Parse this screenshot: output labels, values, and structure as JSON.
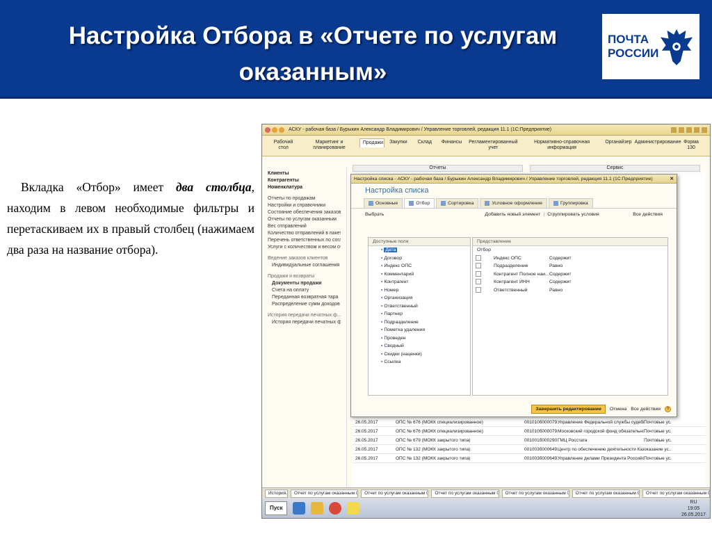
{
  "slide": {
    "title": "Настройка Отбора в «Отчете по услугам оказанным»",
    "logo_line1": "ПОЧТА",
    "logo_line2": "РОССИИ",
    "desc_before": "Вкладка «Отбор» имеет ",
    "desc_emph": "два столбца",
    "desc_after": ", находим в левом необходимые фильтры и перетаскиваем их в правый столбец (нажимаем два раза на название отбора)."
  },
  "app": {
    "title": "АСКУ - рабочая база / Бурыкин Александр Владимирович / Управление торговлей, редакция 11.1 (1С:Предприятие)",
    "sections": [
      "Рабочий стол",
      "Маркетинг и планирование",
      "Продажи",
      "Закупки",
      "Склад",
      "Финансы",
      "Регламентированный учет",
      "Нормативно-справочная информация",
      "Органайзер",
      "Администрирование",
      "Форма 130"
    ],
    "active_section": "Продажи",
    "subtabs": [
      "Отчеты",
      "Сервис"
    ],
    "sidebar": {
      "main": [
        "Клиенты",
        "Контрагенты",
        "Номенклатура"
      ],
      "reports": [
        "Отчеты по продажам",
        "Настройки и справочники",
        "Состояние обеспечения заказов",
        "Отчеты по услугам оказанным",
        "Вес отправлений",
        "Количество отправлений в пакете",
        "Перечень ответственных по соглашениям",
        "Услуги с количеством и весом отправле..."
      ],
      "group1": "Ведение заказов клиентов",
      "g1items": [
        "Индивидуальные соглашения с клиент..."
      ],
      "group2": "Продажи и возвраты",
      "g2items": [
        "Документы продажи",
        "Счета на оплату",
        "Переданная возвратная тара",
        "Распределение сумм доходов на период"
      ],
      "group3": "История передачи печатных ф...",
      "g3items": [
        "История передачи печатных форм"
      ]
    },
    "rows": [
      {
        "date": "26.05.2017",
        "ops": "ОПС № 676 (МОКК специализированное)",
        "code": "001010б000079...",
        "org": "Управление Федеральной службы судебных при...",
        "type": "Почтовые ус..."
      },
      {
        "date": "26.05.2017",
        "ops": "ОПС № 676 (МОКК специализированное)",
        "code": "001010б000079...",
        "org": "Московский городской фонд обязательного мед...",
        "type": "Почтовые ус..."
      },
      {
        "date": "26.05.2017",
        "ops": "ОПС № 679 (МОКК закрытого типа)",
        "code": "001001б000290...",
        "org": "ГМЦ Росстата",
        "type": "Почтовые ус..."
      },
      {
        "date": "26.05.2017",
        "ops": "ОПС № 132 (МОКК закрытого типа)",
        "code": "001003б000649...",
        "org": "Центр по обеспечению деятельности Казначейст...",
        "type": "оказание ус..."
      },
      {
        "date": "26.05.2017",
        "ops": "ОПС № 132 (МОКК закрытого типа)",
        "code": "001003б000649...",
        "org": "Управление делами Президента Российской Фе...",
        "type": "Почтовые ус..."
      }
    ],
    "taskbar_items": [
      "История...",
      "Отчет по услугам оказанным 001000...",
      "Отчет по услугам оказанным 001000...",
      "Отчет по услугам оказанным 001000...",
      "Отчет по услугам оказанным 001000...",
      "Отчет по услугам оказанным 001000...",
      "Отчет по услугам оказанным 001003..."
    ],
    "start": "Пуск",
    "lang": "RU",
    "time": "19:05",
    "date": "26.05.2017"
  },
  "dialog": {
    "title": "Настройка списка - АСКУ - рабочая база / Бурыкин Александр Владимирович / Управление торговлей, редакция 11.1 (1С:Предприятие)",
    "heading": "Настройка списка",
    "tabs": [
      "Основные",
      "Отбор",
      "Сортировка",
      "Условное оформление",
      "Группировка"
    ],
    "active_tab": "Отбор",
    "choose_label": "Выбрать",
    "add_element": "Добавить новый элемент",
    "group_conditions": "Сгруппировать условия",
    "all_actions": "Все действия",
    "left_header": "Доступные поля",
    "left_items": [
      "Дата",
      "Договор",
      "Индекс ОПС",
      "Комментарий",
      "Контрагент",
      "Номер",
      "Организация",
      "Ответственный",
      "Партнер",
      "Подразделение",
      "Пометка удаления",
      "Проведен",
      "Сводный",
      "Скидки (наценки)",
      "Ссылка"
    ],
    "right_header": "Представление",
    "right_root": "Отбор",
    "right_items": [
      {
        "field": "Индекс ОПС",
        "cond": "Содержит"
      },
      {
        "field": "Подразделение",
        "cond": "Равно"
      },
      {
        "field": "Контрагент Полное наи...",
        "cond": "Содержит"
      },
      {
        "field": "Контрагент ИНН",
        "cond": "Содержит"
      },
      {
        "field": "Ответственный",
        "cond": "Равно"
      }
    ],
    "finish_btn": "Завершить редактирование",
    "cancel_btn": "Отмена",
    "foot_actions": "Все действия"
  }
}
